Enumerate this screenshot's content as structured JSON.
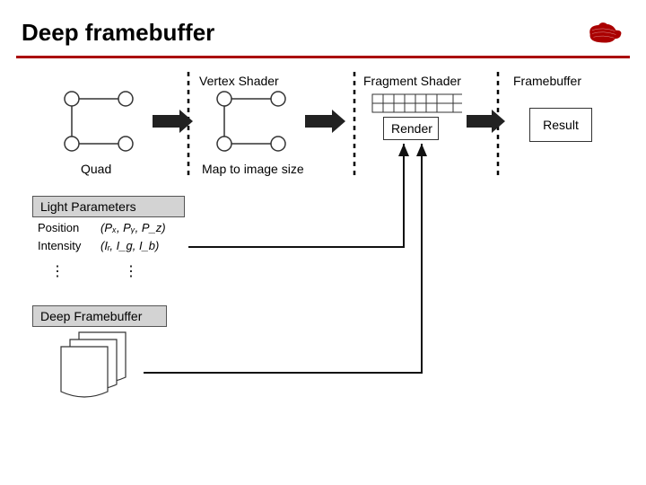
{
  "header": {
    "title": "Deep framebuffer"
  },
  "stages": {
    "vertex_shader": "Vertex Shader",
    "fragment_shader": "Fragment Shader",
    "framebuffer": "Framebuffer",
    "quad": "Quad",
    "map_to_image": "Map to image size",
    "render": "Render",
    "result": "Result"
  },
  "light_params": {
    "header": "Light Parameters",
    "rows": [
      {
        "name": "Position",
        "value": "(Pₓ, Pᵧ, P_z)"
      },
      {
        "name": "Intensity",
        "value": "(Iᵣ, I_g, I_b)"
      }
    ]
  },
  "deep_fb": {
    "header": "Deep Framebuffer"
  },
  "chart_data": {
    "type": "diagram",
    "title": "Deep framebuffer pipeline",
    "nodes": [
      {
        "id": "quad",
        "label": "Quad"
      },
      {
        "id": "vertex_shader",
        "label": "Vertex Shader / Map to image size"
      },
      {
        "id": "fragment_shader",
        "label": "Fragment Shader / Render"
      },
      {
        "id": "framebuffer",
        "label": "Framebuffer / Result"
      },
      {
        "id": "light_params",
        "label": "Light Parameters",
        "fields": [
          "Position (Pₓ,Pᵧ,P_z)",
          "Intensity (Iᵣ,I_g,I_b)"
        ]
      },
      {
        "id": "deep_fb",
        "label": "Deep Framebuffer"
      }
    ],
    "edges": [
      {
        "from": "quad",
        "to": "vertex_shader"
      },
      {
        "from": "vertex_shader",
        "to": "fragment_shader"
      },
      {
        "from": "fragment_shader",
        "to": "framebuffer"
      },
      {
        "from": "light_params",
        "to": "fragment_shader"
      },
      {
        "from": "deep_fb",
        "to": "fragment_shader"
      }
    ]
  }
}
